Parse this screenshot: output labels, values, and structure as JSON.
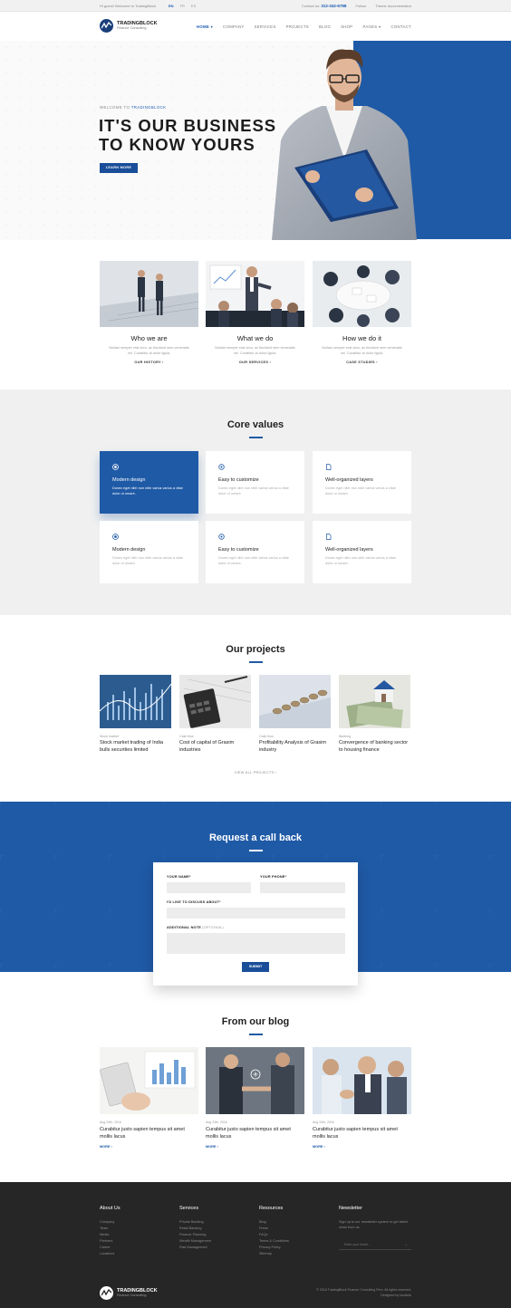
{
  "topbar": {
    "greeting": "Hi guest! Welcome to TradingBlock",
    "languages": [
      "EN",
      "FR",
      "ES"
    ],
    "contact_label": "Contact us:",
    "phone": "312-342-6788",
    "links": [
      "Follow",
      "Theme documentation"
    ]
  },
  "brand": {
    "name": "TRADINGBLOCK",
    "tagline": "Finance Consulting"
  },
  "nav": [
    "HOME ▾",
    "COMPANY",
    "SERVICES",
    "PROJECTS",
    "BLOG",
    "SHOP",
    "PAGES ▾",
    "CONTACT"
  ],
  "hero": {
    "welcome_prefix": "WELCOME TO",
    "welcome_brand": "TRADINGBLOCK",
    "line1": "IT'S OUR BUSINESS",
    "line2": "TO KNOW YOURS",
    "button": "LEARN MORE"
  },
  "about": [
    {
      "title": "Who we are",
      "text": "Nullam semper erat arcu, ac tincidunt sem venenatis vel. Curabitur at dolor ligula.",
      "link": "OUR HISTORY ›"
    },
    {
      "title": "What we do",
      "text": "Nullam semper erat arcu, ac tincidunt sem venenatis vel. Curabitur at dolor ligula.",
      "link": "OUR SERVICES ›"
    },
    {
      "title": "How we do it",
      "text": "Nullam semper erat arcu, ac tincidunt sem venenatis vel. Curabitur at dolor ligula.",
      "link": "CASE STUDIES ›"
    }
  ],
  "core": {
    "title": "Core values",
    "items": [
      {
        "title": "Modern design",
        "text": "Donec eget nibh non nibh varius varius a vitae dolor ut ornare."
      },
      {
        "title": "Easy to customize",
        "text": "Donec eget nibh non nibh varius varius a vitae dolor ut ornare."
      },
      {
        "title": "Well-organized layers",
        "text": "Donec eget nibh non nibh varius varius a vitae dolor ut ornare."
      },
      {
        "title": "Modern design",
        "text": "Donec eget nibh non nibh varius varius a vitae dolor ut ornare."
      },
      {
        "title": "Easy to customize",
        "text": "Donec eget nibh non nibh varius varius a vitae dolor ut ornare."
      },
      {
        "title": "Well-organized layers",
        "text": "Donec eget nibh non nibh varius varius a vitae dolor ut ornare."
      }
    ]
  },
  "projects": {
    "title": "Our projects",
    "items": [
      {
        "category": "Stock market",
        "title": "Stock market trading of India bulls securities limited"
      },
      {
        "category": "Cash flow",
        "title": "Cost of capital of Grasim industries"
      },
      {
        "category": "Cash flow",
        "title": "Profitability Analysis of Grasim industry"
      },
      {
        "category": "Banking",
        "title": "Convergence of banking sector to housing finance"
      }
    ],
    "view_all": "VIEW ALL PROJECTS ›"
  },
  "callback": {
    "title": "Request a call back",
    "name_label": "YOUR NAME*",
    "phone_label": "YOUR PHONE*",
    "discuss_label": "I'D LIKE TO DISCUSS ABOUT*",
    "note_label": "ADDITIONAL NOTE",
    "note_optional": "(OPTIONAL)",
    "submit": "SUBMIT"
  },
  "blog": {
    "title": "From our blog",
    "items": [
      {
        "date": "Aug 24th, 2016",
        "title": "Curabitur justo sapien tempus sit amet mollis lacus",
        "more": "MORE ›"
      },
      {
        "date": "Aug 24th, 2016",
        "title": "Curabitur justo sapien tempus sit amet mollis lacus",
        "more": "MORE ›"
      },
      {
        "date": "Aug 24th, 2016",
        "title": "Curabitur justo sapien tempus sit amet mollis lacus",
        "more": "MORE ›"
      }
    ]
  },
  "footer": {
    "about": {
      "title": "About Us",
      "items": [
        "Company",
        "Team",
        "Media",
        "Partners",
        "Career",
        "Locations"
      ]
    },
    "services": {
      "title": "Services",
      "items": [
        "Private Banking",
        "Retail Banking",
        "Finance Planning",
        "Wealth Management",
        "Risk Management"
      ]
    },
    "resources": {
      "title": "Resources",
      "items": [
        "Blog",
        "Press",
        "FAQs",
        "Terms & Conditions",
        "Privacy Policy",
        "Sitemap"
      ]
    },
    "newsletter": {
      "title": "Newsletter",
      "text": "Sign up to our newsletter system to get latest news from us.",
      "placeholder": "Enter your email..."
    },
    "copyright": "© 2016 TradingBlock Finance Consulting Firm. All rights reserved.",
    "designed": "Designed by tonatuts"
  },
  "colors": {
    "accent": "#1f5aa6",
    "dark": "#262626"
  }
}
